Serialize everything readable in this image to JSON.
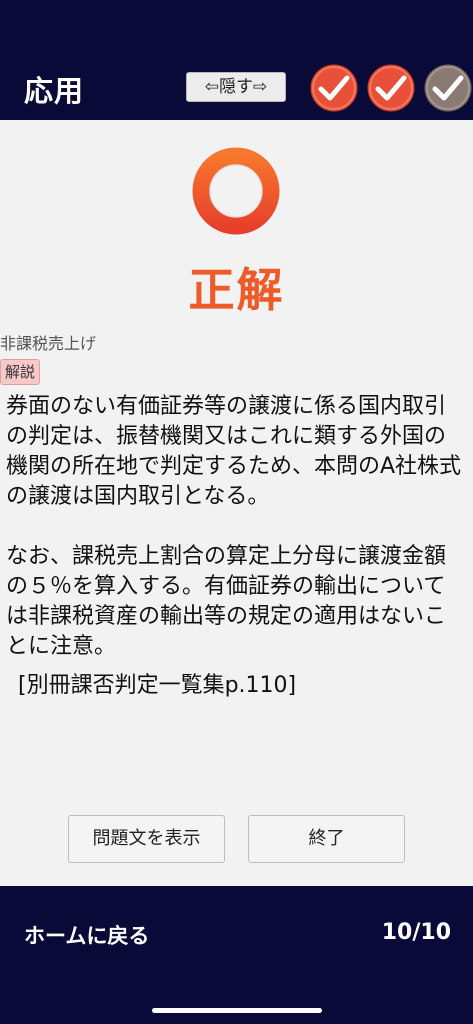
{
  "header": {
    "title": "応用",
    "hide_label": "⇦隠す⇨",
    "badges": [
      {
        "state": "correct",
        "color": "#e8503a"
      },
      {
        "state": "correct",
        "color": "#e8503a"
      },
      {
        "state": "current",
        "color": "#8a7a74"
      }
    ]
  },
  "result": {
    "icon": "circle-correct-icon",
    "label": "正解"
  },
  "question": {
    "category": "非課税売上げ",
    "explanation_tag": "解説",
    "explanation_p1": "券面のない有価証券等の譲渡に係る国内取引の判定は、振替機関又はこれに類する外国の機関の所在地で判定するため、本問のA社株式の譲渡は国内取引となる。",
    "explanation_p2": "なお、課税売上割合の算定上分母に譲渡金額の５％を算入する。有価証券の輸出については非課税資産の輸出等の規定の適用はないことに注意。",
    "reference": "[別冊課否判定一覧集p.110]"
  },
  "actions": {
    "show_question_label": "問題文を表示",
    "finish_label": "終了"
  },
  "footer": {
    "home_label": "ホームに戻る",
    "progress": "10/10"
  },
  "colors": {
    "background": "#0a0a38",
    "accent": "#ee5a28"
  }
}
